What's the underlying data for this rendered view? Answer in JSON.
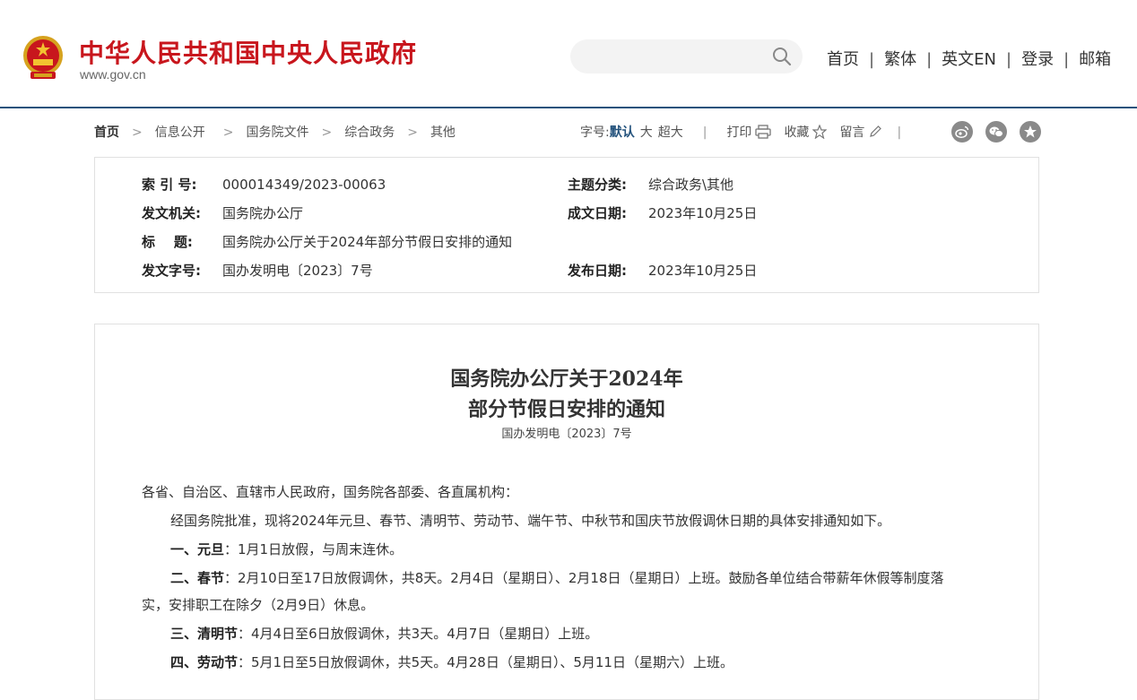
{
  "header": {
    "title": "中华人民共和国中央人民政府",
    "url": "www.gov.cn",
    "search_placeholder": "",
    "nav": [
      "首页",
      "繁体",
      "英文EN",
      "登录",
      "邮箱"
    ],
    "nav_separator": "|"
  },
  "breadcrumb": {
    "items": [
      "首页",
      "信息公开",
      "国务院文件",
      "综合政务",
      "其他"
    ],
    "separator": ">"
  },
  "toolbar": {
    "font_size_label": "字号:",
    "font_default": "默认",
    "font_large": "大",
    "font_xlarge": "超大",
    "print": "打印",
    "favorite": "收藏",
    "comment": "留言",
    "separator": "|"
  },
  "share_icons": [
    "weibo-icon",
    "wechat-icon",
    "star-icon"
  ],
  "meta": {
    "index_label": "索 引 号:",
    "index_value": "000014349/2023-00063",
    "topic_label": "主题分类:",
    "topic_value": "综合政务\\其他",
    "issuer_label": "发文机关:",
    "issuer_value": "国务院办公厅",
    "written_label": "成文日期:",
    "written_value": "2023年10月25日",
    "title_label": "标    题:",
    "title_value": "国务院办公厅关于2024年部分节假日安排的通知",
    "docno_label": "发文字号:",
    "docno_value": "国办发明电〔2023〕7号",
    "published_label": "发布日期:",
    "published_value": "2023年10月25日"
  },
  "article": {
    "title_line1": "国务院办公厅关于2024年",
    "title_line2": "部分节假日安排的通知",
    "doc_number": "国办发明电〔2023〕7号",
    "salutation": "各省、自治区、直辖市人民政府，国务院各部委、各直属机构：",
    "intro": "经国务院批准，现将2024年元旦、春节、清明节、劳动节、端午节、中秋节和国庆节放假调休日期的具体安排通知如下。",
    "item1_head": "一、元旦",
    "item1_body": "：1月1日放假，与周末连休。",
    "item2_head": "二、春节",
    "item2_body": "：2月10日至17日放假调休，共8天。2月4日（星期日）、2月18日（星期日）上班。鼓励各单位结合带薪年休假等制度落",
    "item2_cont": "实，安排职工在除夕（2月9日）休息。",
    "item3_head": "三、清明节",
    "item3_body": "：4月4日至6日放假调休，共3天。4月7日（星期日）上班。",
    "item4_head": "四、劳动节",
    "item4_body": "：5月1日至5日放假调休，共5天。4月28日（星期日）、5月11日（星期六）上班。"
  },
  "colors": {
    "brand_red": "#c8161d",
    "header_line": "#23527c",
    "active_font": "#23527c",
    "border": "#e1e1e1"
  }
}
